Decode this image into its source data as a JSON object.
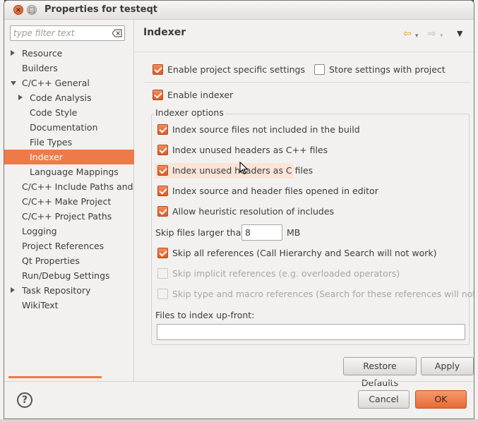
{
  "window": {
    "title": "Properties for testeqt"
  },
  "filter": {
    "placeholder": "type filter text"
  },
  "nav": {
    "items": [
      {
        "label": "Resource",
        "expander": "right",
        "level": 0
      },
      {
        "label": "Builders",
        "expander": "none",
        "level": 0
      },
      {
        "label": "C/C++ General",
        "expander": "down",
        "level": 0
      },
      {
        "label": "Code Analysis",
        "expander": "right",
        "level": 1
      },
      {
        "label": "Code Style",
        "expander": "none",
        "level": 1
      },
      {
        "label": "Documentation",
        "expander": "none",
        "level": 1
      },
      {
        "label": "File Types",
        "expander": "none",
        "level": 1
      },
      {
        "label": "Indexer",
        "expander": "none",
        "level": 1,
        "selected": true
      },
      {
        "label": "Language Mappings",
        "expander": "none",
        "level": 1
      },
      {
        "label": "C/C++ Include Paths and Symbols",
        "expander": "none",
        "level": 0
      },
      {
        "label": "C/C++ Make Project",
        "expander": "none",
        "level": 0
      },
      {
        "label": "C/C++ Project Paths",
        "expander": "none",
        "level": 0
      },
      {
        "label": "Logging",
        "expander": "none",
        "level": 0
      },
      {
        "label": "Project References",
        "expander": "none",
        "level": 0
      },
      {
        "label": "Qt Properties",
        "expander": "none",
        "level": 0
      },
      {
        "label": "Run/Debug Settings",
        "expander": "none",
        "level": 0
      },
      {
        "label": "Task Repository",
        "expander": "right",
        "level": 0
      },
      {
        "label": "WikiText",
        "expander": "none",
        "level": 0
      }
    ]
  },
  "panel": {
    "title": "Indexer",
    "enable_project_specific": "Enable project specific settings",
    "store_with_project": "Store settings with project",
    "enable_indexer": "Enable indexer",
    "group_title": "Indexer options",
    "options": [
      "Index source files not included in the build",
      "Index unused headers as C++ files",
      "Index unused headers as C files",
      "Index source and header files opened in editor",
      "Allow heuristic resolution of includes"
    ],
    "skip_files_label": "Skip files larger than:",
    "skip_files_value": "8",
    "skip_files_unit": "MB",
    "skip_all_refs": "Skip all references (Call Hierarchy and Search will not work)",
    "skip_implicit_refs": "Skip implicit references (e.g. overloaded operators)",
    "skip_type_macro_refs": "Skip type and macro references (Search for these references will not work)",
    "files_upfront_label": "Files to index up-front:",
    "files_upfront_value": "",
    "restore_defaults": "Restore Defaults",
    "apply": "Apply"
  },
  "footer": {
    "help": "?",
    "cancel": "Cancel",
    "ok": "OK"
  },
  "colors": {
    "accent": "#ef7a49",
    "background": "#f2f1f0"
  }
}
